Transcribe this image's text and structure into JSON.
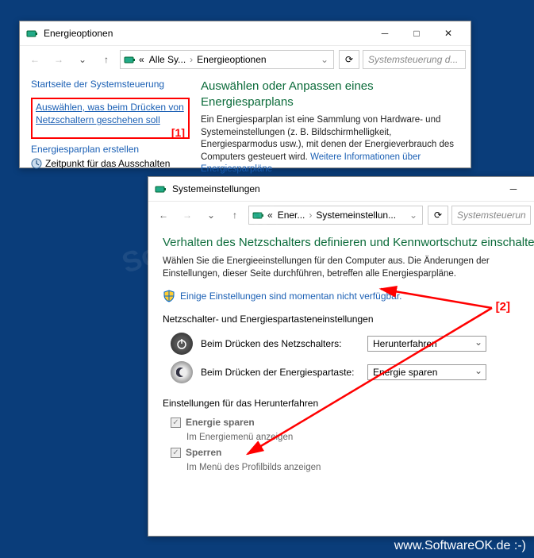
{
  "window1": {
    "title": "Energieoptionen",
    "breadcrumb": {
      "prefix": "«",
      "part1": "Alle Sy...",
      "part2": "Energieoptionen"
    },
    "search_placeholder": "Systemsteuerung d...",
    "left": {
      "home": "Startseite der Systemsteuerung",
      "link1": "Auswählen, was beim Drücken von Netzschaltern geschehen soll",
      "marker": "[1]",
      "plan": "Energiesparplan erstellen",
      "shutdown": "Zeitpunkt für das Ausschalten"
    },
    "right": {
      "heading": "Auswählen oder Anpassen eines Energiesparplans",
      "body": "Ein Energiesparplan ist eine Sammlung von Hardware- und Systemeinstellungen (z. B. Bildschirmhelligkeit, Energiesparmodus usw.), mit denen der Energieverbrauch des Computers gesteuert wird. ",
      "morelink": "Weitere Informationen über Energiesparpläne"
    }
  },
  "window2": {
    "title": "Systemeinstellungen",
    "breadcrumb": {
      "prefix": "«",
      "part1": "Ener...",
      "part2": "Systemeinstellun..."
    },
    "search_placeholder": "Systemsteuerun",
    "heading": "Verhalten des Netzschalters definieren und Kennwortschutz einschalten",
    "desc": "Wählen Sie die Energieeinstellungen für den Computer aus. Die Änderungen der Einstellungen, dieser Seite durchführen, betreffen alle Energiesparpläne.",
    "shieldlink": "Einige Einstellungen sind momentan nicht verfügbar.",
    "section1": "Netzschalter- und Energiespartasteneinstellungen",
    "row1label": "Beim Drücken des Netzschalters:",
    "row1value": "Herunterfahren",
    "row2label": "Beim Drücken der Energiespartaste:",
    "row2value": "Energie sparen",
    "section2": "Einstellungen für das Herunterfahren",
    "cb1": "Energie sparen",
    "cb1sub": "Im Energiemenü anzeigen",
    "cb2": "Sperren",
    "cb2sub": "Im Menü des Profilbilds anzeigen"
  },
  "marker2": "[2]",
  "watermark": "SoftwareOK",
  "footer": "www.SoftwareOK.de :-)"
}
